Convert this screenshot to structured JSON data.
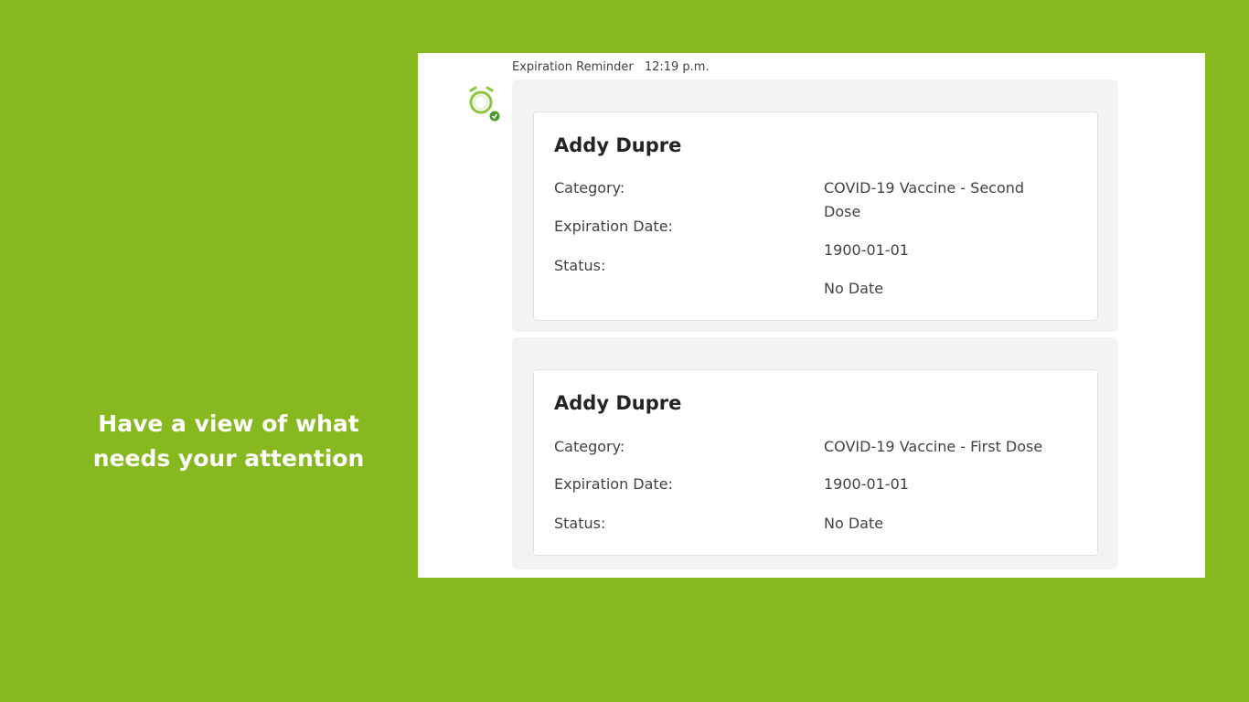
{
  "tagline": {
    "line1": "Have a view of what",
    "line2": "needs your attention"
  },
  "header": {
    "sender": "Expiration Reminder",
    "time": "12:19 p.m."
  },
  "colors": {
    "background": "#88b81f",
    "avatar_green": "#8cc63f",
    "status_dot": "#4a9a2c"
  },
  "avatar_icon": "alarm-clock-icon",
  "cards": [
    {
      "name": "Addy Dupre",
      "category_label": "Category:",
      "category_value": "COVID-19 Vaccine - Second Dose",
      "expiration_label": "Expiration Date:",
      "expiration_value": "1900-01-01",
      "status_label": "Status:",
      "status_value": "No Date"
    },
    {
      "name": "Addy Dupre",
      "category_label": "Category:",
      "category_value": "COVID-19 Vaccine - First Dose",
      "expiration_label": "Expiration Date:",
      "expiration_value": "1900-01-01",
      "status_label": "Status:",
      "status_value": "No Date"
    }
  ]
}
